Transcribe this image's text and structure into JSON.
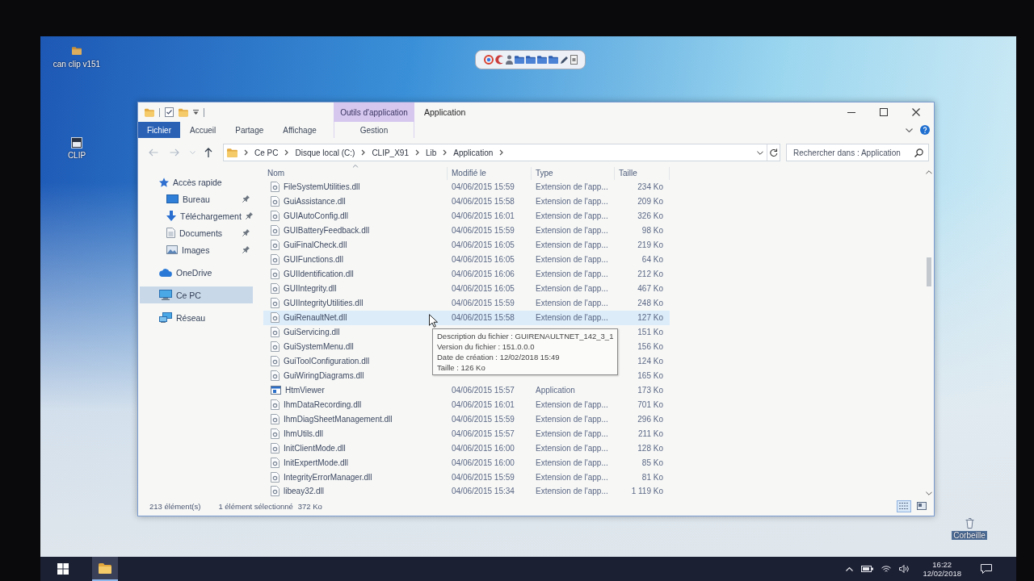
{
  "desktop": {
    "icons": [
      {
        "label": "can clip v151"
      },
      {
        "label": "CLIP"
      }
    ],
    "recycle_bin": {
      "label": "Corbeille"
    }
  },
  "window": {
    "title": "Application",
    "ribbon": {
      "file_tab": "Fichier",
      "tabs": [
        {
          "label": "Accueil",
          "selected": false
        },
        {
          "label": "Partage",
          "selected": false
        },
        {
          "label": "Affichage",
          "selected": false
        }
      ],
      "context": {
        "title": "Outils d'application",
        "tabs": [
          {
            "label": "Gestion",
            "selected": false
          }
        ]
      }
    },
    "address": {
      "path": [
        "Ce PC",
        "Disque local (C:)",
        "CLIP_X91",
        "Lib",
        "Application"
      ]
    },
    "search": {
      "placeholder": "Rechercher dans : Application"
    },
    "sidebar": {
      "items": [
        {
          "label": "Accès rapide",
          "selected": false,
          "children": [
            {
              "label": "Bureau",
              "pinned": true,
              "selected": false
            },
            {
              "label": "Téléchargement",
              "pinned": true,
              "selected": false
            },
            {
              "label": "Documents",
              "pinned": true,
              "selected": false
            },
            {
              "label": "Images",
              "pinned": true,
              "selected": false
            }
          ]
        },
        {
          "label": "OneDrive",
          "selected": false
        },
        {
          "label": "Ce PC",
          "selected": true
        },
        {
          "label": "Réseau",
          "selected": false
        }
      ]
    },
    "table": {
      "columns": [
        {
          "label": "Nom",
          "sorted": true
        },
        {
          "label": "Modifié le",
          "sorted": false
        },
        {
          "label": "Type",
          "sorted": false
        },
        {
          "label": "Taille",
          "sorted": false
        }
      ],
      "rows": [
        {
          "kind": "library",
          "name": "FileSystemUtilities.dll",
          "modified": "04/06/2015 15:59",
          "type": "Extension de l'app...",
          "size": "234 Ko",
          "hovered": false
        },
        {
          "kind": "library",
          "name": "GuiAssistance.dll",
          "modified": "04/06/2015 15:58",
          "type": "Extension de l'app...",
          "size": "209 Ko",
          "hovered": false
        },
        {
          "kind": "library",
          "name": "GUIAutoConfig.dll",
          "modified": "04/06/2015 16:01",
          "type": "Extension de l'app...",
          "size": "326 Ko",
          "hovered": false
        },
        {
          "kind": "library",
          "name": "GUIBatteryFeedback.dll",
          "modified": "04/06/2015 15:59",
          "type": "Extension de l'app...",
          "size": "98 Ko",
          "hovered": false
        },
        {
          "kind": "library",
          "name": "GuiFinalCheck.dll",
          "modified": "04/06/2015 16:05",
          "type": "Extension de l'app...",
          "size": "219 Ko",
          "hovered": false
        },
        {
          "kind": "library",
          "name": "GUIFunctions.dll",
          "modified": "04/06/2015 16:05",
          "type": "Extension de l'app...",
          "size": "64 Ko",
          "hovered": false
        },
        {
          "kind": "library",
          "name": "GUIIdentification.dll",
          "modified": "04/06/2015 16:06",
          "type": "Extension de l'app...",
          "size": "212 Ko",
          "hovered": false
        },
        {
          "kind": "library",
          "name": "GUIIntegrity.dll",
          "modified": "04/06/2015 16:05",
          "type": "Extension de l'app...",
          "size": "467 Ko",
          "hovered": false
        },
        {
          "kind": "library",
          "name": "GUIIntegrityUtilities.dll",
          "modified": "04/06/2015 15:59",
          "type": "Extension de l'app...",
          "size": "248 Ko",
          "hovered": false
        },
        {
          "kind": "library",
          "name": "GuiRenaultNet.dll",
          "modified": "04/06/2015 15:58",
          "type": "Extension de l'app...",
          "size": "127 Ko",
          "hovered": true
        },
        {
          "kind": "library",
          "name": "GuiServicing.dll",
          "size": "151 Ko",
          "hovered": false
        },
        {
          "kind": "library",
          "name": "GuiSystemMenu.dll",
          "size": "156 Ko",
          "hovered": false
        },
        {
          "kind": "library",
          "name": "GuiToolConfiguration.dll",
          "size": "124 Ko",
          "hovered": false
        },
        {
          "kind": "library",
          "name": "GuiWiringDiagrams.dll",
          "size": "165 Ko",
          "hovered": false
        },
        {
          "kind": "application",
          "name": "HtmViewer",
          "modified": "04/06/2015 15:57",
          "type": "Application",
          "size": "173 Ko",
          "hovered": false
        },
        {
          "kind": "library",
          "name": "IhmDataRecording.dll",
          "modified": "04/06/2015 16:01",
          "type": "Extension de l'app...",
          "size": "701 Ko",
          "hovered": false
        },
        {
          "kind": "library",
          "name": "IhmDiagSheetManagement.dll",
          "modified": "04/06/2015 15:59",
          "type": "Extension de l'app...",
          "size": "296 Ko",
          "hovered": false
        },
        {
          "kind": "library",
          "name": "IhmUtils.dll",
          "modified": "04/06/2015 15:57",
          "type": "Extension de l'app...",
          "size": "211 Ko",
          "hovered": false
        },
        {
          "kind": "library",
          "name": "InitClientMode.dll",
          "modified": "04/06/2015 16:00",
          "type": "Extension de l'app...",
          "size": "128 Ko",
          "hovered": false
        },
        {
          "kind": "library",
          "name": "InitExpertMode.dll",
          "modified": "04/06/2015 16:00",
          "type": "Extension de l'app...",
          "size": "85 Ko",
          "hovered": false
        },
        {
          "kind": "library",
          "name": "IntegrityErrorManager.dll",
          "modified": "04/06/2015 15:59",
          "type": "Extension de l'app...",
          "size": "81 Ko",
          "hovered": false
        },
        {
          "kind": "library",
          "name": "libeay32.dll",
          "modified": "04/06/2015 15:34",
          "type": "Extension de l'app...",
          "size": "1 119 Ko",
          "hovered": false
        }
      ]
    },
    "tooltip": {
      "lines": [
        "Description du fichier : GUIRENAULTNET_142_3_1",
        "Version du fichier : 151.0.0.0",
        "Date de création : 12/02/2018 15:49",
        "Taille : 126 Ko"
      ]
    },
    "status_bar": {
      "count": "213 élément(s)",
      "selection": "1 élément sélectionné",
      "selection_size": "372 Ko",
      "views": [
        {
          "kind": "details",
          "selected": true
        },
        {
          "kind": "large_icons",
          "selected": false
        }
      ]
    }
  },
  "taskbar": {
    "apps": [
      {
        "active": true
      }
    ],
    "clock": {
      "time": "16:22",
      "date": "12/02/2018"
    }
  }
}
